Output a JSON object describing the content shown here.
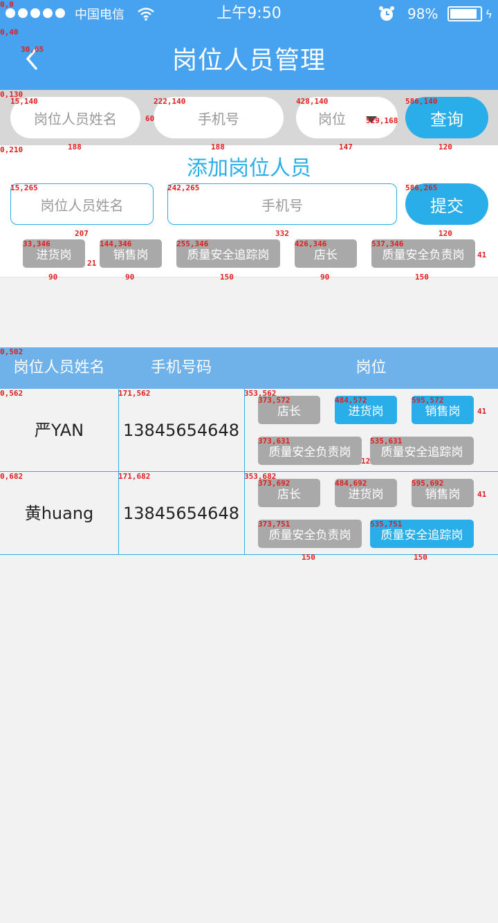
{
  "status_bar": {
    "carrier": "中国电信",
    "time": "上午9:50",
    "battery": "98%"
  },
  "header": {
    "title": "岗位人员管理"
  },
  "search": {
    "name_placeholder": "岗位人员姓名",
    "phone_placeholder": "手机号",
    "post_placeholder": "岗位",
    "query_label": "查询"
  },
  "add": {
    "title": "添加岗位人员",
    "name_placeholder": "岗位人员姓名",
    "phone_placeholder": "手机号",
    "submit_label": "提交",
    "tags": [
      "进货岗",
      "销售岗",
      "质量安全追踪岗",
      "店长",
      "质量安全负责岗"
    ]
  },
  "table": {
    "headers": {
      "name": "岗位人员姓名",
      "phone": "手机号码",
      "post": "岗位"
    },
    "rows": [
      {
        "name": "严YAN",
        "phone": "13845654648",
        "tags": [
          {
            "label": "店长",
            "selected": false
          },
          {
            "label": "进货岗",
            "selected": true
          },
          {
            "label": "销售岗",
            "selected": true
          },
          {
            "label": "质量安全负责岗",
            "selected": false
          },
          {
            "label": "质量安全追踪岗",
            "selected": false
          }
        ]
      },
      {
        "name": "黄huang",
        "phone": "13845654648",
        "tags": [
          {
            "label": "店长",
            "selected": false
          },
          {
            "label": "进货岗",
            "selected": false
          },
          {
            "label": "销售岗",
            "selected": false
          },
          {
            "label": "质量安全负责岗",
            "selected": false
          },
          {
            "label": "质量安全追踪岗",
            "selected": true
          }
        ]
      }
    ]
  },
  "annotations": [
    "0,0",
    "0,40",
    "30,65",
    "0,130",
    "15,140",
    "222,140",
    "428,140",
    "586,140",
    "529,168",
    "0,210",
    "60",
    "188",
    "147",
    "120",
    "15,265",
    "242,265",
    "586,265",
    "207",
    "332",
    "33,346",
    "144,346",
    "255,346",
    "426,346",
    "537,346",
    "41",
    "21",
    "90",
    "150",
    "0,502",
    "0,562",
    "171,562",
    "353,562",
    "373,572",
    "484,572",
    "595,572",
    "373,631",
    "535,631",
    "12",
    "0,682",
    "171,682",
    "353,682",
    "373,692",
    "484,692",
    "595,692",
    "373,751",
    "535,751"
  ],
  "colors": {
    "primary": "#47a2f0",
    "accent": "#2aaee9",
    "tag_off": "#a9a9a9",
    "table_head": "#6fb2ea"
  }
}
